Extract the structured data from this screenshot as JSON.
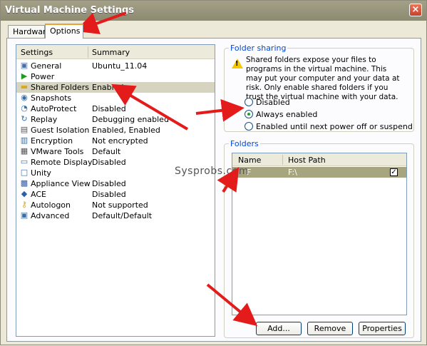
{
  "window": {
    "title": "Virtual Machine Settings",
    "close_glyph": "×"
  },
  "tabs": [
    {
      "label": "Hardware",
      "active": false
    },
    {
      "label": "Options",
      "active": true
    }
  ],
  "settings_list": {
    "headers": {
      "settings": "Settings",
      "summary": "Summary"
    },
    "items": [
      {
        "name": "General",
        "summary": "Ubuntu_11.04",
        "icon": "general-icon"
      },
      {
        "name": "Power",
        "summary": "",
        "icon": "power-icon"
      },
      {
        "name": "Shared Folders",
        "summary": "Enabled",
        "icon": "folder-icon",
        "selected": true
      },
      {
        "name": "Snapshots",
        "summary": "",
        "icon": "snapshots-icon"
      },
      {
        "name": "AutoProtect",
        "summary": "Disabled",
        "icon": "autoprotect-icon"
      },
      {
        "name": "Replay",
        "summary": "Debugging enabled",
        "icon": "replay-icon"
      },
      {
        "name": "Guest Isolation",
        "summary": "Enabled, Enabled",
        "icon": "guest-isolation-icon"
      },
      {
        "name": "Encryption",
        "summary": "Not encrypted",
        "icon": "encryption-icon"
      },
      {
        "name": "VMware Tools",
        "summary": "Default",
        "icon": "vmware-tools-icon"
      },
      {
        "name": "Remote Display",
        "summary": "Disabled",
        "icon": "remote-display-icon"
      },
      {
        "name": "Unity",
        "summary": "",
        "icon": "unity-icon"
      },
      {
        "name": "Appliance View",
        "summary": "Disabled",
        "icon": "appliance-view-icon"
      },
      {
        "name": "ACE",
        "summary": "Disabled",
        "icon": "ace-icon"
      },
      {
        "name": "Autologon",
        "summary": "Not supported",
        "icon": "autologon-icon"
      },
      {
        "name": "Advanced",
        "summary": "Default/Default",
        "icon": "advanced-icon"
      }
    ]
  },
  "folder_sharing": {
    "label": "Folder sharing",
    "warning": "Shared folders expose your files to programs in the virtual machine. This may put your computer and your data at risk. Only enable shared folders if you trust the virtual machine with your data.",
    "options": [
      {
        "label": "Disabled",
        "selected": false
      },
      {
        "label": "Always enabled",
        "selected": true
      },
      {
        "label": "Enabled until next power off or suspend",
        "selected": false
      }
    ]
  },
  "folders": {
    "label": "Folders",
    "headers": {
      "name": "Name",
      "host_path": "Host Path"
    },
    "rows": [
      {
        "name": "F",
        "host_path": "F:\\",
        "checked": true
      }
    ],
    "buttons": {
      "add": "Add...",
      "remove": "Remove",
      "properties": "Properties"
    }
  },
  "watermark": "Sysprobs.com",
  "colors": {
    "selection": "#d6d3bf",
    "folder_row": "#a6a57f",
    "annotation_arrow": "#e31b1b",
    "titlebar": "#9a977f"
  }
}
